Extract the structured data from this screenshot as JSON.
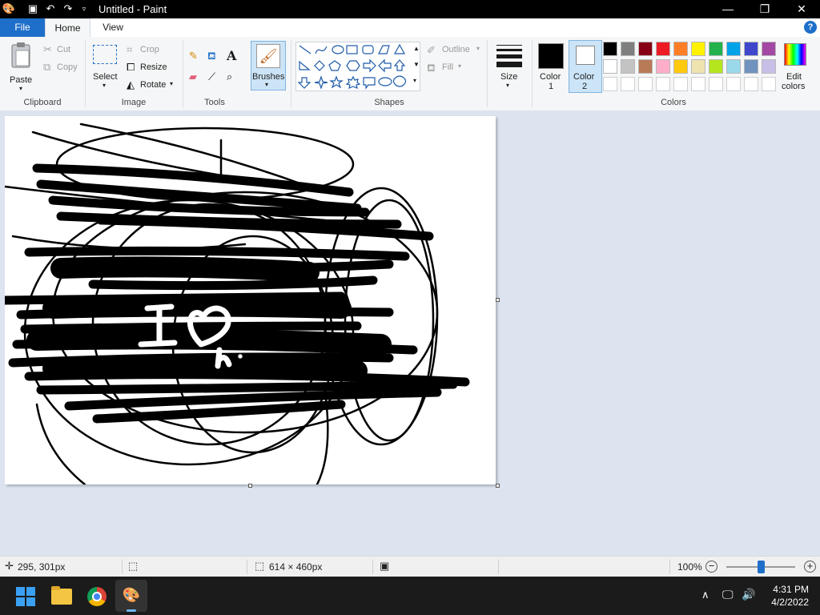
{
  "window": {
    "title": "Untitled - Paint",
    "minimize": "—",
    "maximize": "❐",
    "close": "✕"
  },
  "tabs": {
    "file": "File",
    "home": "Home",
    "view": "View",
    "help": "?"
  },
  "ribbon": {
    "clipboard": {
      "paste": "Paste",
      "cut": "Cut",
      "copy": "Copy",
      "group": "Clipboard"
    },
    "image": {
      "select": "Select",
      "crop": "Crop",
      "resize": "Resize",
      "rotate": "Rotate",
      "group": "Image"
    },
    "tools": {
      "group": "Tools",
      "text_icon": "A"
    },
    "brushes": "Brushes",
    "shapes": {
      "outline": "Outline",
      "fill": "Fill",
      "group": "Shapes"
    },
    "size": "Size",
    "color1": {
      "line1": "Color",
      "line2": "1",
      "value": "#000000"
    },
    "color2": {
      "line1": "Color",
      "line2": "2",
      "value": "#ffffff"
    },
    "colors_group": "Colors",
    "edit_colors": {
      "line1": "Edit",
      "line2": "colors"
    },
    "palette_row1": [
      "#000000",
      "#7f7f7f",
      "#880015",
      "#ed1c24",
      "#ff7f27",
      "#fff200",
      "#22b14c",
      "#00a2e8",
      "#3f48cc",
      "#a349a4"
    ],
    "palette_row2": [
      "#ffffff",
      "#c3c3c3",
      "#b97a57",
      "#ffaec9",
      "#ffc90e",
      "#efe4b0",
      "#b5e61d",
      "#99d9ea",
      "#7092be",
      "#c8bfe7"
    ]
  },
  "canvas": {
    "drawn_text_1": "I",
    "drawn_text_2": "♥",
    "drawn_text_3": "h"
  },
  "status": {
    "cursor_pos": "295, 301px",
    "image_size": "614 × 460px",
    "zoom": "100%",
    "zoom_level": 0.5
  },
  "taskbar": {
    "time": "4:31 PM",
    "date": "4/2/2022"
  }
}
